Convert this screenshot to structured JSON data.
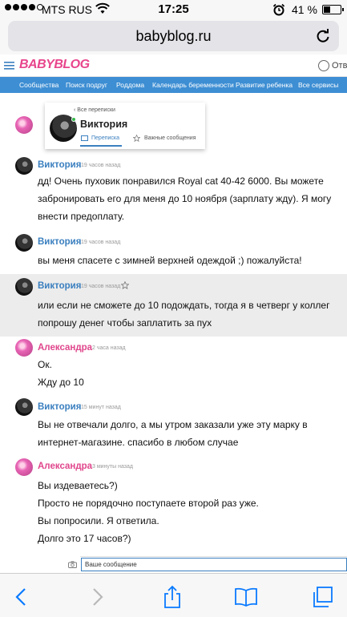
{
  "status_bar": {
    "carrier": "MTS RUS",
    "time": "17:25",
    "battery_percent_text": "41 %",
    "battery_level": 0.41,
    "signal_dots_filled": 4,
    "signal_dots_total": 5
  },
  "browser": {
    "url": "babyblog.ru"
  },
  "site": {
    "logo": "BABYBLOG",
    "reply_link": "Ответ",
    "nav": [
      "Сообщества",
      "Поиск подруг",
      "Роддома",
      "Календарь беременности",
      "Развитие ребенка",
      "Все сервисы"
    ]
  },
  "popup": {
    "back_link": "Все переписки",
    "name": "Виктория",
    "tab_messages": "Переписка",
    "tab_important": "Важные сообщения"
  },
  "messages": [
    {
      "author": "Виктория",
      "time": "19 часов назад",
      "lines": [
        "дд! Очень пуховик понравился Royal cat 40-42 6000. Вы можете",
        "забронировать его для меня до 10 ноября (зарплату жду). Я могу",
        "внести предоплату."
      ]
    },
    {
      "author": "Виктория",
      "time": "19 часов назад",
      "lines": [
        "вы меня спасете с зимней верхней одеждой ;) пожалуйста!"
      ]
    },
    {
      "author": "Виктория",
      "time": "19 часов назад",
      "lines": [
        "или если не сможете до 10 подождать, тогда я в четверг у коллег",
        "попрошу денег чтобы заплатить за пух"
      ]
    },
    {
      "author": "Александра",
      "time": "2 часа назад",
      "lines": [
        "Ок.",
        "Жду до 10"
      ]
    },
    {
      "author": "Виктория",
      "time": "15 минут назад",
      "lines": [
        "Вы не отвечали долго, а мы утром заказали уже эту марку в",
        "интернет-магазине. спасибо в любом случае"
      ]
    },
    {
      "author": "Александра",
      "time": "3 минуты назад",
      "lines": [
        "Вы издеваетесь?)",
        "Просто не порядочно поступаете второй раз уже.",
        "Вы попросили. Я ответила.",
        "Долго это 17 часов?)"
      ]
    }
  ],
  "compose": {
    "placeholder": "Ваше сообщение"
  },
  "colors": {
    "nav_blue": "#3d8ed3",
    "author_blue": "#3a7fbf",
    "author_pink": "#e0468c",
    "highlight_gray": "#ececec"
  }
}
